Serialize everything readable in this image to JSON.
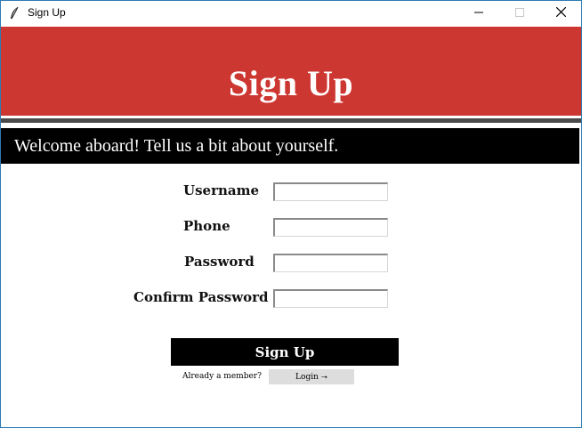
{
  "window": {
    "title": "Sign Up",
    "minimize_icon": "minimize-icon",
    "maximize_icon": "maximize-icon",
    "close_icon": "close-icon"
  },
  "header": {
    "title": "Sign Up",
    "background_color": "#cd3731"
  },
  "welcome": {
    "text": "Welcome aboard! Tell us a bit about yourself."
  },
  "form": {
    "fields": [
      {
        "label": "Username",
        "value": ""
      },
      {
        "label": "Phone",
        "value": ""
      },
      {
        "label": "Password",
        "value": ""
      },
      {
        "label": "Confirm Password",
        "value": ""
      }
    ]
  },
  "actions": {
    "signup_label": "Sign Up",
    "member_text": "Already a member?",
    "login_label": "Login ⭢"
  }
}
